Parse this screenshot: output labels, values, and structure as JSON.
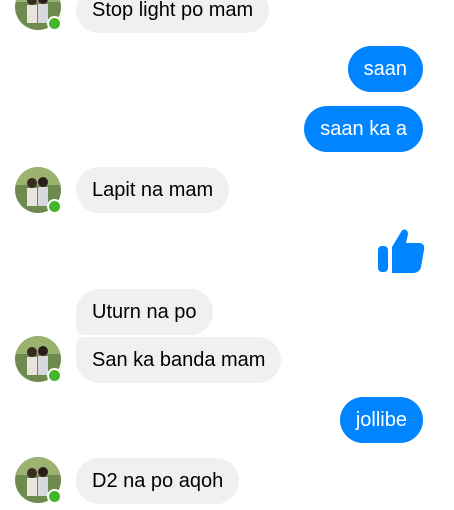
{
  "conversation": {
    "contact_avatar_icon": "contact-avatar-photo",
    "online_indicator_color": "#42b72a",
    "incoming_bubble_color": "#f1f0f0",
    "outgoing_bubble_color": "#0084ff",
    "messages": [
      {
        "direction": "incoming",
        "text": "Stop light po mam"
      },
      {
        "direction": "outgoing",
        "text": "saan"
      },
      {
        "direction": "outgoing",
        "text": "saan ka a"
      },
      {
        "direction": "incoming",
        "text": "Lapit na mam"
      },
      {
        "direction": "outgoing",
        "type": "like",
        "icon": "thumbs-up-icon"
      },
      {
        "direction": "incoming",
        "text": "Uturn na po"
      },
      {
        "direction": "incoming",
        "text": "San ka banda mam"
      },
      {
        "direction": "outgoing",
        "text": "jollibe"
      },
      {
        "direction": "incoming",
        "text": "D2 na po aqoh"
      }
    ]
  }
}
